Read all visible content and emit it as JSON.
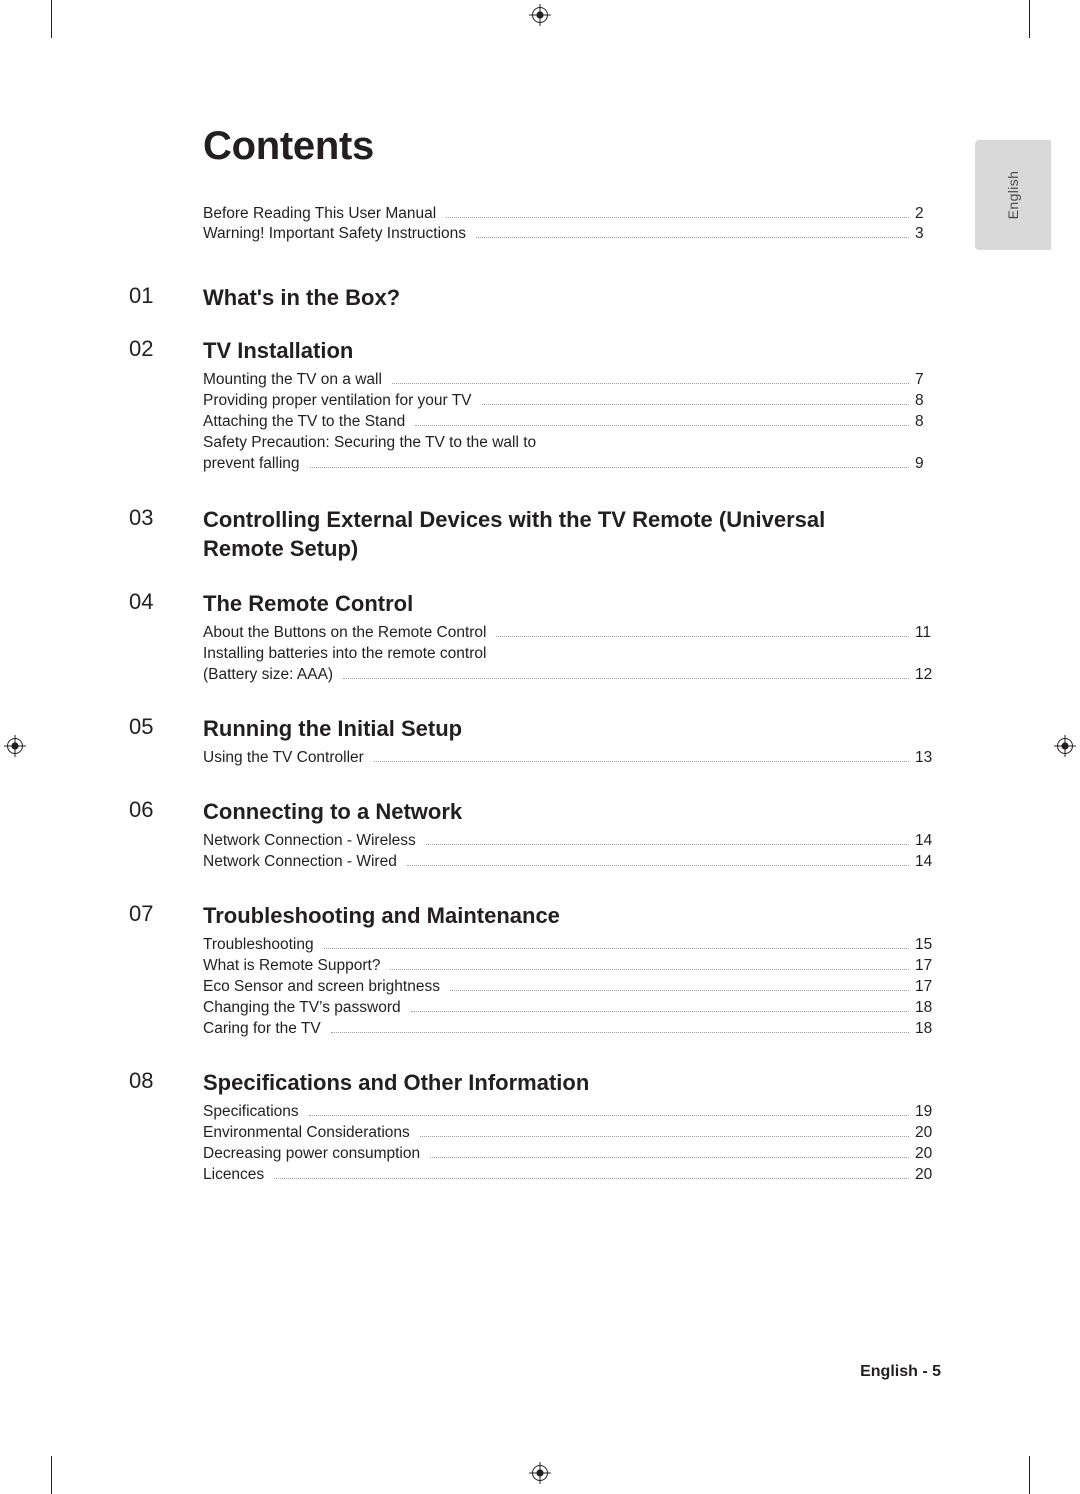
{
  "page": {
    "title": "Contents",
    "footer": "English - 5",
    "language_tab": "English"
  },
  "intro_entries": [
    {
      "label": "Before Reading This User Manual",
      "page": "2"
    },
    {
      "label": "Warning! Important Safety Instructions",
      "page": "3"
    }
  ],
  "chapters": [
    {
      "number": "01",
      "title": "What's in the Box?",
      "entries": []
    },
    {
      "number": "02",
      "title": "TV Installation",
      "entries": [
        {
          "label": "Mounting the TV on a wall",
          "page": "7",
          "leader": true
        },
        {
          "label": "Providing proper ventilation for your TV",
          "page": "8",
          "leader": true
        },
        {
          "label": "Attaching the TV to the Stand",
          "page": "8",
          "leader": true
        },
        {
          "label": "Safety Precaution: Securing the TV to the wall to",
          "page": "",
          "leader": false
        },
        {
          "label": "prevent falling",
          "page": "9",
          "leader": true
        }
      ]
    },
    {
      "number": "03",
      "title": "Controlling External Devices with the TV Remote (Universal Remote Setup)",
      "entries": []
    },
    {
      "number": "04",
      "title": "The Remote Control",
      "entries": [
        {
          "label": "About the Buttons on the Remote Control",
          "page": "11",
          "leader": true
        },
        {
          "label": "Installing batteries into the remote control",
          "page": "",
          "leader": false
        },
        {
          "label": "(Battery size: AAA)",
          "page": "12",
          "leader": true
        }
      ]
    },
    {
      "number": "05",
      "title": "Running the Initial Setup",
      "entries": [
        {
          "label": "Using the TV Controller",
          "page": "13",
          "leader": true
        }
      ]
    },
    {
      "number": "06",
      "title": "Connecting to a Network",
      "entries": [
        {
          "label": "Network Connection - Wireless",
          "page": "14",
          "leader": true
        },
        {
          "label": "Network Connection - Wired",
          "page": "14",
          "leader": true
        }
      ]
    },
    {
      "number": "07",
      "title": "Troubleshooting and Maintenance",
      "entries": [
        {
          "label": "Troubleshooting",
          "page": "15",
          "leader": true
        },
        {
          "label": "What is Remote Support?",
          "page": "17",
          "leader": true
        },
        {
          "label": "Eco Sensor and screen brightness",
          "page": "17",
          "leader": true
        },
        {
          "label": "Changing the TV’s password",
          "page": "18",
          "leader": true
        },
        {
          "label": "Caring for the TV",
          "page": "18",
          "leader": true
        }
      ]
    },
    {
      "number": "08",
      "title": "Specifications and Other Information",
      "entries": [
        {
          "label": "Specifications",
          "page": "19",
          "leader": true
        },
        {
          "label": "Environmental Considerations",
          "page": "20",
          "leader": true
        },
        {
          "label": "Decreasing power consumption",
          "page": "20",
          "leader": true
        },
        {
          "label": "Licences",
          "page": "20",
          "leader": true
        }
      ]
    }
  ],
  "colors": {
    "text": "#231f20",
    "leader": "#9a9a9a",
    "tab_bg": "#d9d9d9"
  }
}
